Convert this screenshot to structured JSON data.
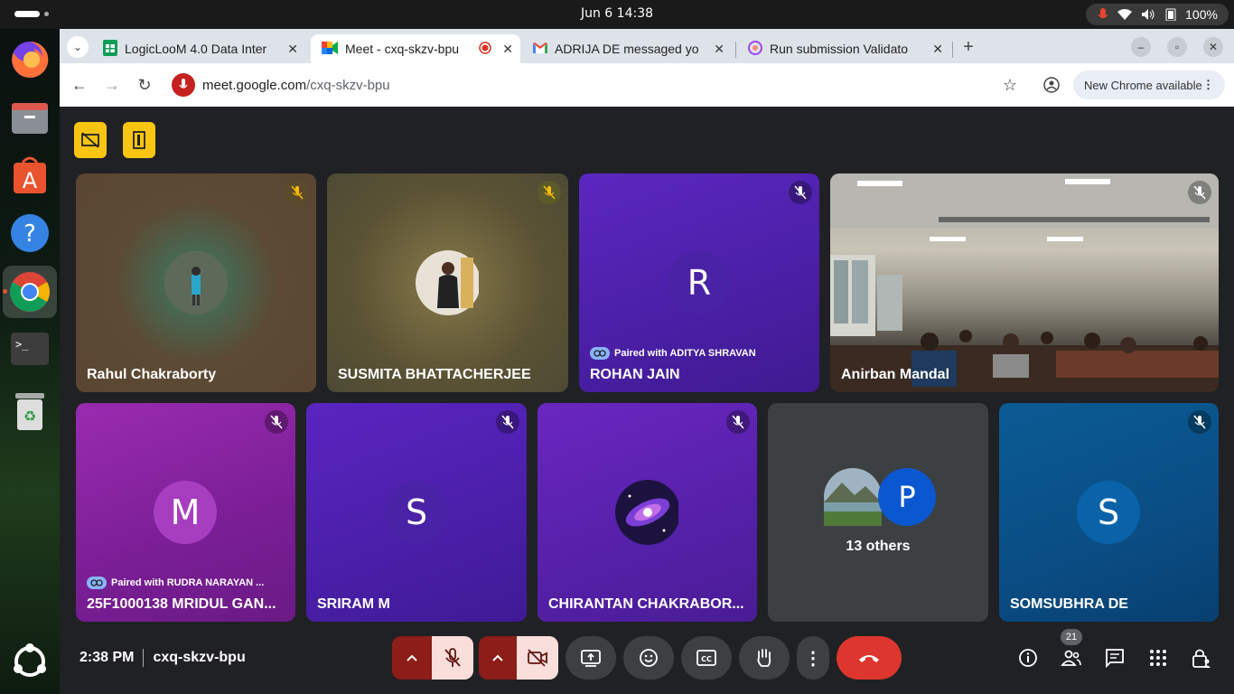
{
  "system": {
    "clock": "Jun 6  14:38",
    "battery": "100%"
  },
  "browser": {
    "tabs": [
      {
        "title": "LogicLooM 4.0 Data Inter",
        "icon": "sheets-icon"
      },
      {
        "title": "Meet - cxq-skzv-bpu",
        "icon": "meet-icon",
        "active": true
      },
      {
        "title": "ADRIJA DE messaged yo",
        "icon": "gmail-icon"
      },
      {
        "title": "Run submission Validato",
        "icon": "validator-icon"
      }
    ],
    "url_domain": "meet.google.com",
    "url_path": "/cxq-skzv-bpu",
    "update_label": "New Chrome available"
  },
  "meet": {
    "tiles_row1": [
      {
        "name": "Rahul Chakraborty"
      },
      {
        "name": "SUSMITA BHATTACHERJEE"
      },
      {
        "name": "ROHAN JAIN",
        "initial": "R",
        "paired": "Paired with ADITYA SHRAVAN"
      },
      {
        "name": "Anirban Mandal"
      }
    ],
    "tiles_row2": [
      {
        "name": "25F1000138 MRIDUL GAN...",
        "initial": "M",
        "paired": "Paired with RUDRA NARAYAN ..."
      },
      {
        "name": "SRIRAM M",
        "initial": "S"
      },
      {
        "name": "CHIRANTAN CHAKRABOR..."
      },
      {
        "name": "13 others",
        "initial": "P"
      },
      {
        "name": "SOMSUBHRA DE",
        "initial": "S"
      }
    ],
    "time": "2:38 PM",
    "meeting_code": "cxq-skzv-bpu",
    "participants_count": "21"
  }
}
